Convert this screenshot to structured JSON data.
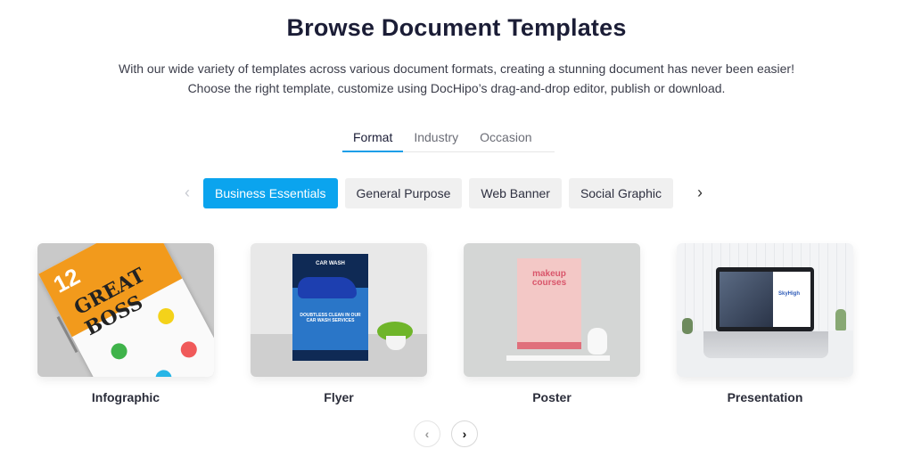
{
  "header": {
    "title": "Browse Document Templates",
    "subtitle": "With our wide variety of templates across various document formats, creating a stunning document has never been easier! Choose the right template, customize using DocHipo’s drag-and-drop editor, publish or download."
  },
  "tabs": [
    {
      "label": "Format",
      "active": true
    },
    {
      "label": "Industry",
      "active": false
    },
    {
      "label": "Occasion",
      "active": false
    }
  ],
  "chips": {
    "prev_icon": "‹",
    "next_icon": "›",
    "items": [
      {
        "label": "Business Essentials",
        "active": true
      },
      {
        "label": "General Purpose",
        "active": false
      },
      {
        "label": "Web Banner",
        "active": false
      },
      {
        "label": "Social Graphic",
        "active": false
      }
    ]
  },
  "cards": [
    {
      "label": "Infographic",
      "thumb": {
        "number": "12",
        "headline": "GREAT BOSS"
      }
    },
    {
      "label": "Flyer",
      "thumb": {
        "headline": "CAR WASH",
        "tagline": "DOUBTLESS CLEAN IN OUR CAR WASH SERVICES"
      }
    },
    {
      "label": "Poster",
      "thumb": {
        "headline": "makeup courses"
      }
    },
    {
      "label": "Presentation",
      "thumb": {
        "brand": "SkyHigh"
      }
    }
  ],
  "pager": {
    "prev_icon": "‹",
    "next_icon": "›"
  },
  "colors": {
    "accent": "#0ba4ee",
    "tab_underline": "#1a9ee8",
    "title": "#1b1d36"
  }
}
